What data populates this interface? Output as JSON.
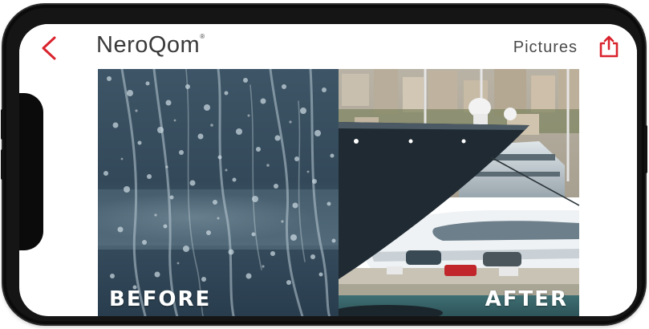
{
  "app": {
    "logo_text": "NeroQom",
    "logo_mark": "®"
  },
  "nav": {
    "back_icon": "chevron-left-icon",
    "title": "Pictures",
    "share_icon": "share-icon"
  },
  "photos": {
    "before_label": "BEFORE",
    "after_label": "AFTER"
  },
  "colors": {
    "accent": "#d9232d",
    "logo_text": "#3a3a3a",
    "label_text": "#ffffff"
  }
}
